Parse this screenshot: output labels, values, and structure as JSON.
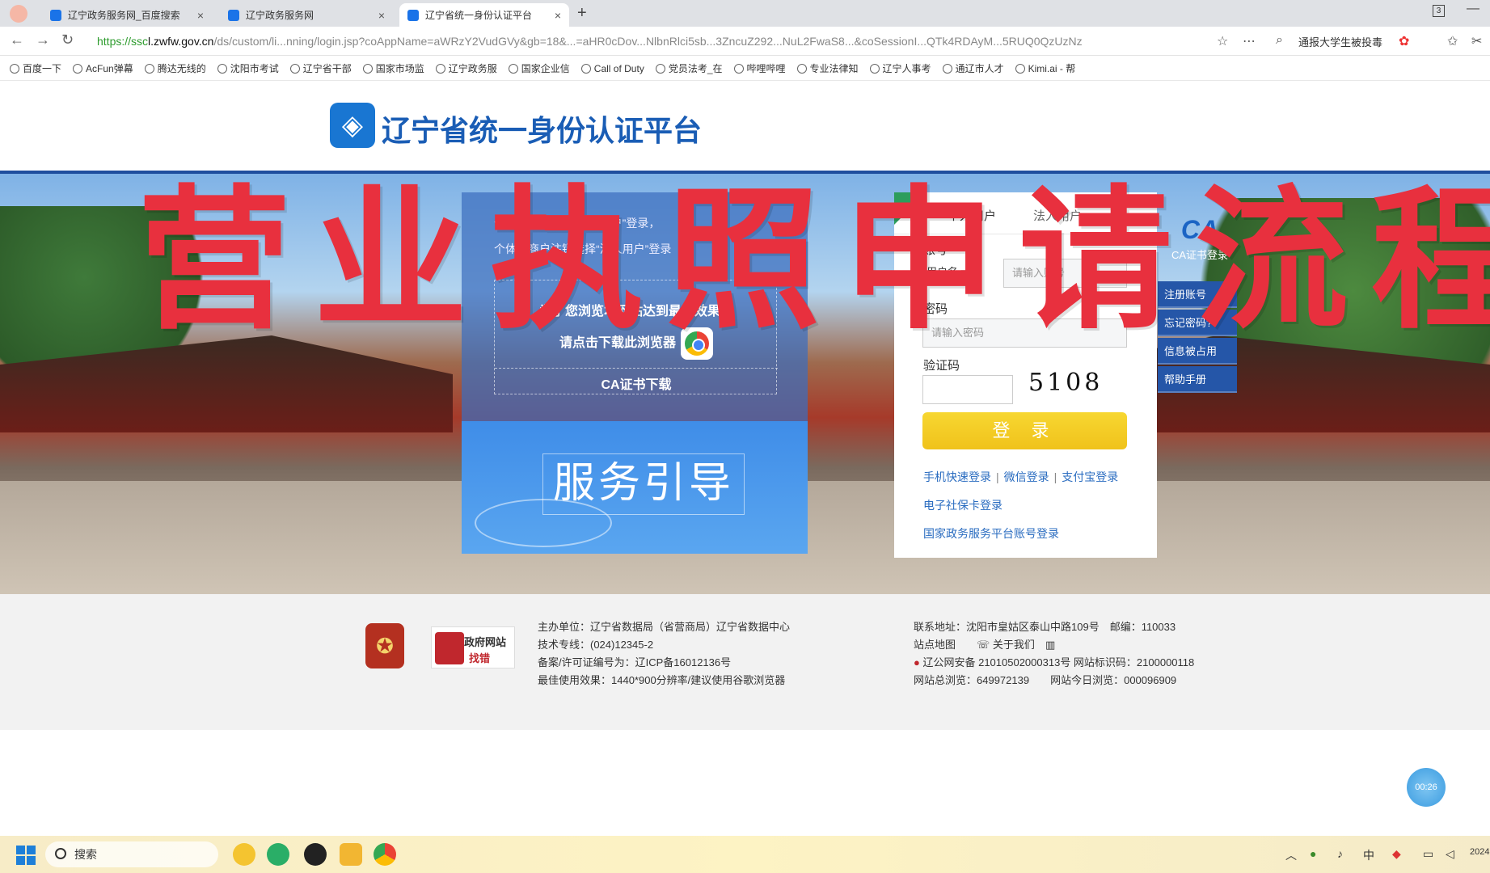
{
  "browser": {
    "tabs": [
      {
        "label": "辽宁政务服务网_百度搜索",
        "active": false
      },
      {
        "label": "辽宁政务服务网",
        "active": false
      },
      {
        "label": "辽宁省统一身份认证平台",
        "active": true
      }
    ],
    "new_tab": "+",
    "close": "×",
    "tab_count": "3",
    "url": {
      "scheme": "https://ssc",
      "host": "l.zwfw.gov.cn",
      "path": "/ds/custom/li...nning/login.jsp?coAppName=aWRzY2VudGVy&gb=18&...=aHR0cDov...NlbnRlci5sb...3ZncuZ292...NuL2FwaS8...&coSessionI...QTk4RDAyM...5RUQ0QzUzNz"
    },
    "address_extra": "通报大学生被投毒",
    "bookmarks": [
      "百度一下",
      "AcFun弹幕",
      "腾达无线的",
      "沈阳市考试",
      "辽宁省干部",
      "国家市场监",
      "辽宁政务服",
      "国家企业信",
      "Call of Duty",
      "党员法考_在",
      "哔哩哔哩",
      "专业法律知",
      "辽宁人事考",
      "通辽市人才",
      "Kimi.ai - 帮"
    ]
  },
  "site": {
    "title": "辽宁省统一身份认证平台"
  },
  "watermark": "营业执照申请流程",
  "center_panel": {
    "note_line1": "个体工商户选择“个人用户”登录，",
    "note_line2": "个体工商户注销选择“法人用户”登录",
    "browser_tip_line1": "为了您浏览本网站达到最佳效果，",
    "browser_tip_line2": "请点击下载此浏览器",
    "ca_download": "CA证书下载",
    "guide_title": "服务引导"
  },
  "login": {
    "tab_personal": "个人用户",
    "tab_legal": "法人用户",
    "account_label": "账号",
    "account_type": "用户名",
    "account_placeholder": "请输入账号",
    "password_label": "密码",
    "password_placeholder": "请输入密码",
    "captcha_label": "验证码",
    "captcha_value": "",
    "captcha_image": "5108",
    "submit": "登 录",
    "link_phone": "手机快速登录",
    "link_wechat": "微信登录",
    "link_alipay": "支付宝登录",
    "link_social": "电子社保卡登录",
    "link_national": "国家政务服务平台账号登录"
  },
  "side_menu": {
    "ca_logo": "CA",
    "ca_label": "CA证书登录",
    "items": [
      "注册账号",
      "忘记密码?",
      "信息被占用",
      "帮助手册"
    ]
  },
  "footer": {
    "emblem_label": "党政机关",
    "gov_error_line1": "政府网站",
    "gov_error_line2": "找错",
    "host": "主办单位：辽宁省数据局（省营商局）辽宁省数据中心",
    "hotline": "技术专线：(024)12345-2",
    "icp": "备案/许可证编号为：辽ICP备16012136号",
    "best_view": "最佳使用效果：1440*900分辨率/建议使用谷歌浏览器",
    "address": "联系地址：沈阳市皇姑区泰山中路109号　邮编：110033",
    "sitemap": "站点地图",
    "about": "关于我们",
    "security": "辽公网安备 21010502000313号 网站标识码：2100000118",
    "total_visits": "网站总浏览：649972139",
    "today_visits": "网站今日浏览：000096909"
  },
  "timer": "00:26",
  "taskbar": {
    "search_label": "搜索",
    "clock": "2024"
  },
  "colors": {
    "brand_blue": "#1a5db5",
    "watermark_red": "#e8303e",
    "login_button": "#f0c21b",
    "side_menu": "#2556a8"
  }
}
